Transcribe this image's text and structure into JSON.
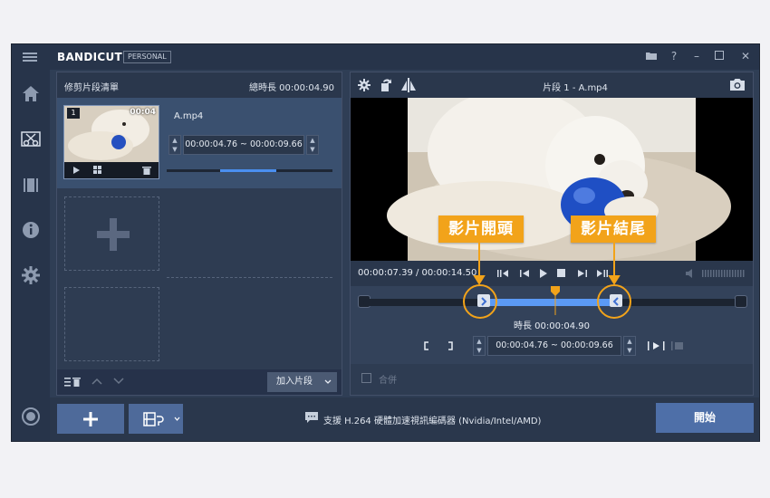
{
  "app": {
    "logo_text": "BANDICUT",
    "edition": "PERSONAL",
    "window_controls": [
      "folder-icon",
      "help-icon",
      "minimize-icon",
      "maximize-icon",
      "close-icon"
    ]
  },
  "sidebar": {
    "items": [
      {
        "name": "home",
        "icon": "home-icon"
      },
      {
        "name": "cut",
        "icon": "scissors-icon"
      },
      {
        "name": "film",
        "icon": "film-icon"
      },
      {
        "name": "info",
        "icon": "info-icon"
      },
      {
        "name": "settings",
        "icon": "gear-icon"
      },
      {
        "name": "record",
        "icon": "record-icon"
      }
    ]
  },
  "clip_list": {
    "title": "修剪片段清單",
    "total_duration": "總時長 00:00:04.90",
    "items": [
      {
        "index": "1",
        "thumb_duration": "00:04",
        "filename": "A.mp4",
        "range": "00:00:04.76 ~ 00:00:09.66",
        "range_fraction": [
          0.32,
          0.66
        ]
      }
    ],
    "add_segment_label": "加入片段"
  },
  "preview": {
    "title": "片段 1 - A.mp4",
    "time_readout": "00:00:07.39 / 00:00:14.50",
    "segment_duration": "時長 00:00:04.90",
    "range_text": "00:00:04.76 ~ 00:00:09.66",
    "range_fraction": [
      0.32,
      0.67
    ],
    "playhead_fraction": 0.51,
    "merge_label": "合併"
  },
  "callouts": {
    "start_label": "影片開頭",
    "end_label": "影片結尾",
    "color": "#f2a31a"
  },
  "bottom": {
    "status_text": "支援 H.264 硬體加速視訊編碼器 (Nvidia/Intel/AMD)",
    "start_label": "開始"
  },
  "colors": {
    "accent": "#4a8ff0",
    "panel": "#2e3c52",
    "callout": "#f2a31a"
  }
}
